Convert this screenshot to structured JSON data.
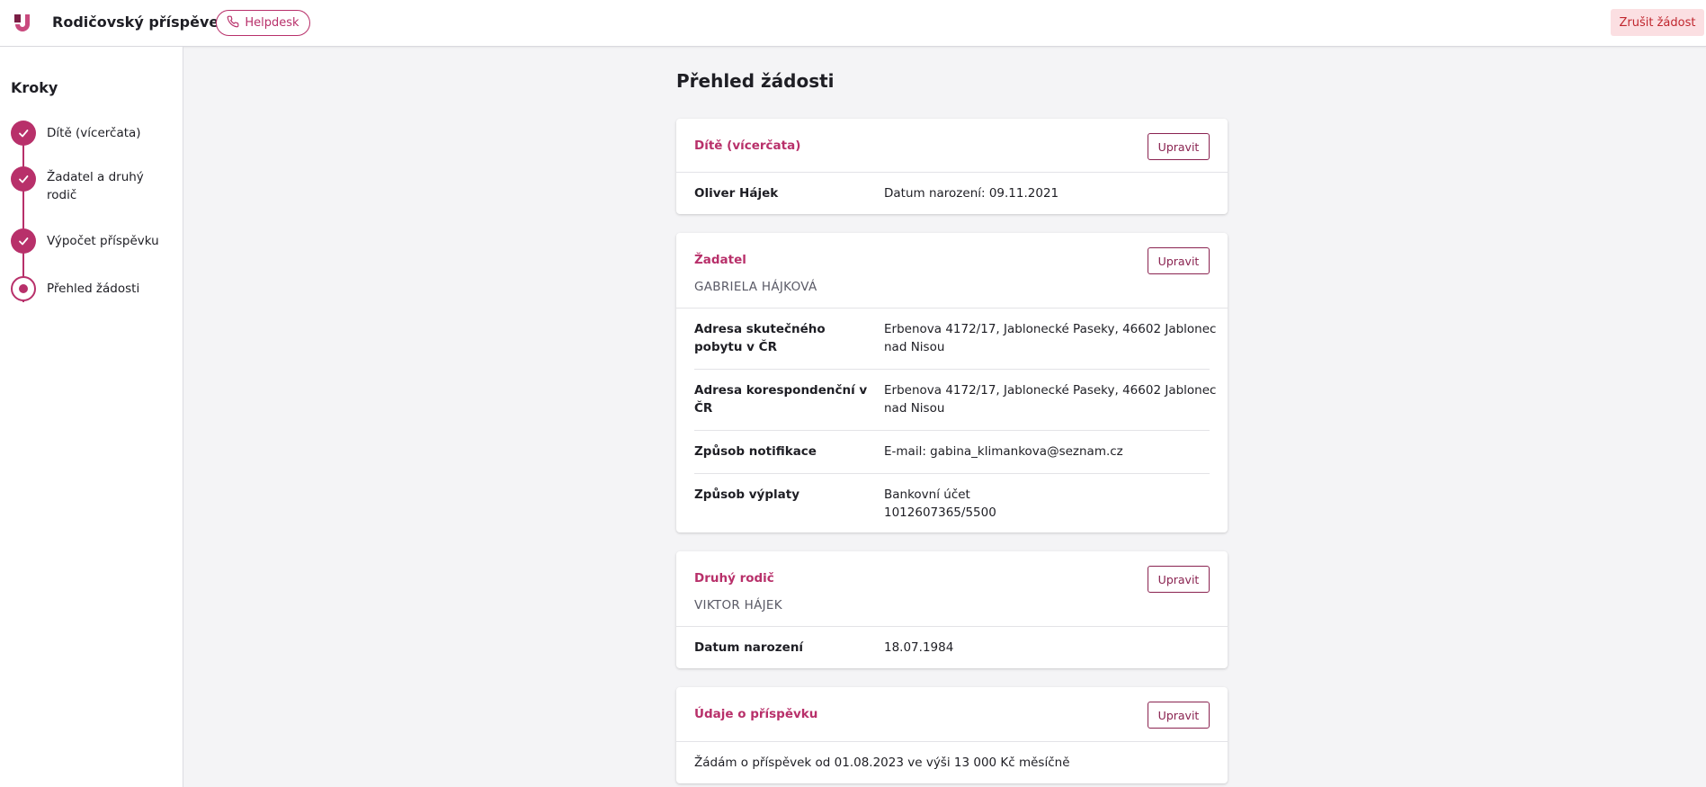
{
  "header": {
    "app_title": "Rodičovský příspěvek",
    "helpdesk_label": "Helpdesk",
    "cancel_label": "Zrušit žádost"
  },
  "sidebar": {
    "title": "Kroky",
    "steps": [
      {
        "label": "Dítě (vícerčata)",
        "state": "done"
      },
      {
        "label": "Žadatel a druhý rodič",
        "state": "done"
      },
      {
        "label": "Výpočet příspěvku",
        "state": "done"
      },
      {
        "label": "Přehled žádosti",
        "state": "current"
      }
    ]
  },
  "main": {
    "title": "Přehled žádosti",
    "edit_label": "Upravit",
    "cards": {
      "child": {
        "title": "Dítě (vícerčata)",
        "rows": [
          {
            "label": "Oliver Hájek",
            "value": "Datum narození: 09.11.2021"
          }
        ]
      },
      "applicant": {
        "title": "Žadatel",
        "subtitle": "GABRIELA HÁJKOVÁ",
        "rows": [
          {
            "label": "Adresa skutečného pobytu v ČR",
            "value": "Erbenova 4172/17, Jablonecké Paseky, 46602 Jablonec nad Nisou"
          },
          {
            "label": "Adresa korespondenční v ČR",
            "value": "Erbenova 4172/17, Jablonecké Paseky, 46602 Jablonec nad Nisou"
          },
          {
            "label": "Způsob notifikace",
            "value": "E-mail: gabina_klimankova@seznam.cz"
          },
          {
            "label": "Způsob výplaty",
            "value": "Bankovní účet",
            "value2": "1012607365/5500"
          }
        ]
      },
      "second_parent": {
        "title": "Druhý rodič",
        "subtitle": "VIKTOR HÁJEK",
        "rows": [
          {
            "label": "Datum narození",
            "value": "18.07.1984"
          }
        ]
      },
      "contribution": {
        "title": "Údaje o příspěvku",
        "rows": [
          {
            "text": "Žádám o příspěvek od 01.08.2023 ve výši 13 000 Kč měsíčně"
          }
        ]
      }
    }
  },
  "colors": {
    "accent": "#b8306a",
    "cancel_bg": "#fbdfe2",
    "cancel_text": "#c0262e"
  }
}
